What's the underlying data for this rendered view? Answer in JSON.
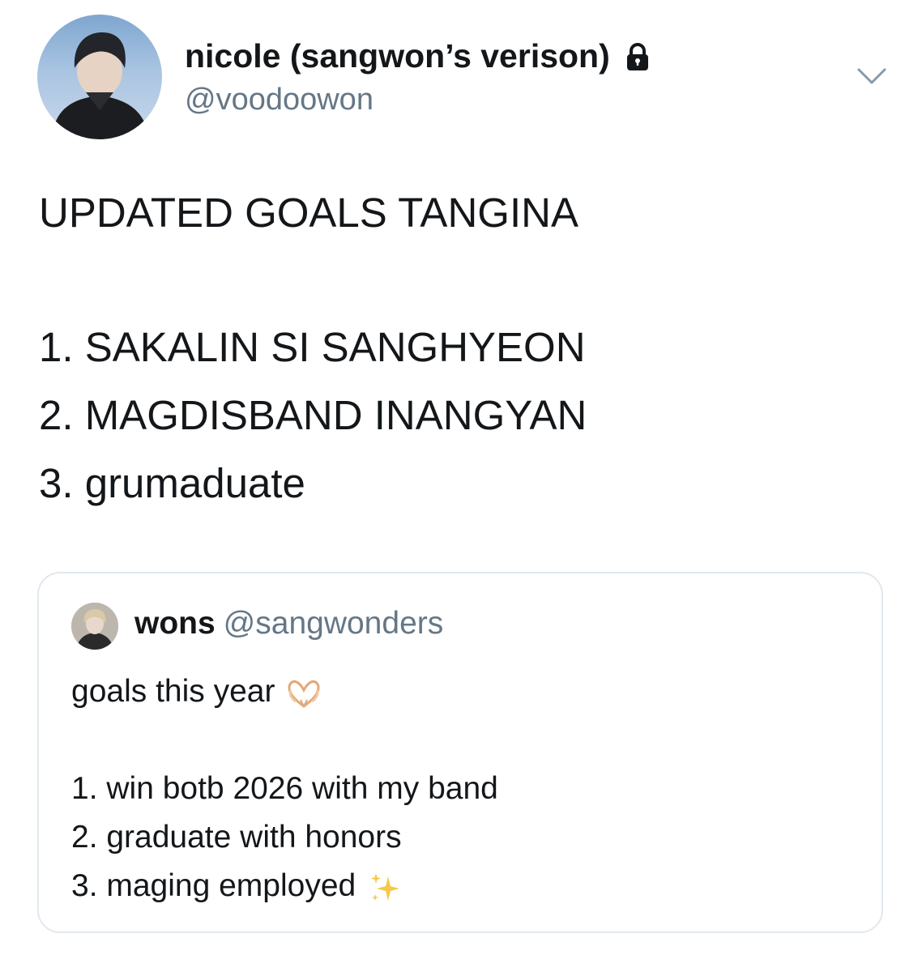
{
  "author": {
    "display_name": "nicole (sangwon’s verison)",
    "handle": "@voodoowon",
    "protected_icon": "lock-icon",
    "avatar_icon": "profile-photo"
  },
  "menu_icon": "chevron-down-icon",
  "tweet": {
    "lines": [
      "UPDATED GOALS TANGINA",
      "",
      "1. SAKALIN SI SANGHYEON",
      "2. MAGDISBAND INANGYAN",
      "3. grumaduate"
    ]
  },
  "quoted_tweet": {
    "display_name": "wons",
    "handle": "@sangwonders",
    "avatar_icon": "profile-photo",
    "lines": [
      "goals this year",
      "",
      "1. win botb 2026 with my band",
      "2. graduate with honors",
      "3. maging employed"
    ],
    "emojis": [
      "heart-hands-emoji",
      "sparkles-emoji"
    ]
  },
  "colors": {
    "text": "#14171a",
    "secondary": "#657786",
    "border": "#e1e8ed"
  }
}
